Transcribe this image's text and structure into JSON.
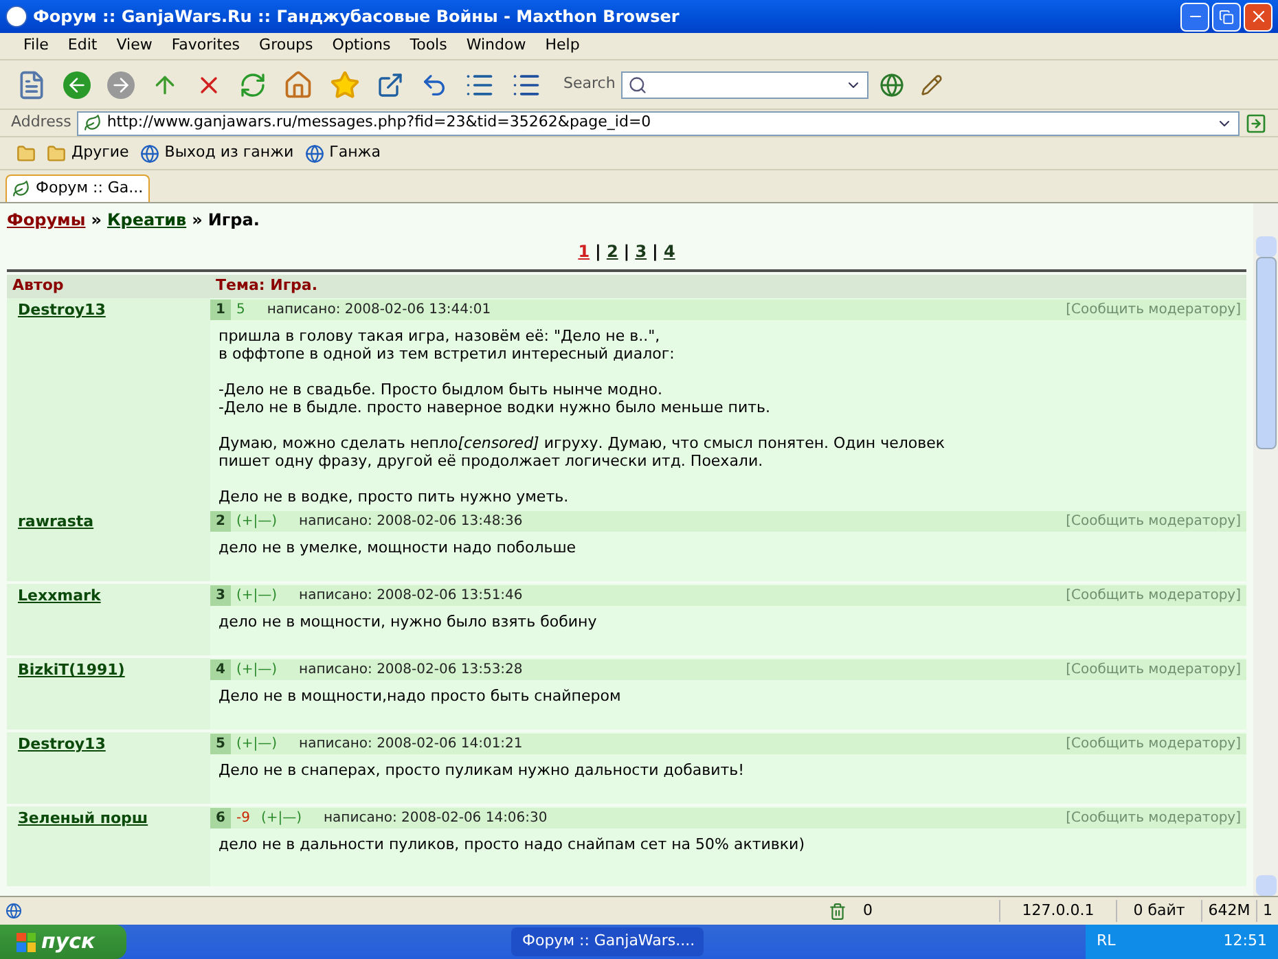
{
  "window": {
    "title": "Форум :: GanjaWars.Ru :: Ганджубасовые Войны - Maxthon Browser"
  },
  "menu": [
    "File",
    "Edit",
    "View",
    "Favorites",
    "Groups",
    "Options",
    "Tools",
    "Window",
    "Help"
  ],
  "search": {
    "label": "Search"
  },
  "address": {
    "label": "Address",
    "url": "http://www.ganjawars.ru/messages.php?fid=23&tid=35262&page_id=0"
  },
  "links": [
    {
      "kind": "folder"
    },
    {
      "kind": "folder",
      "label": "Другие"
    },
    {
      "kind": "page",
      "label": "Выход из ганжи"
    },
    {
      "kind": "page",
      "label": "Ганжа"
    }
  ],
  "tabs": [
    {
      "label": "Форум :: Ga...",
      "selected": true
    }
  ],
  "breadcrumb": [
    {
      "kind": "link",
      "label": "Форумы",
      "color": "#8b0000"
    },
    {
      "kind": "sep",
      "label": "»"
    },
    {
      "kind": "link",
      "label": "Креатив",
      "color": "#004400"
    },
    {
      "kind": "sep",
      "label": "»"
    },
    {
      "kind": "text",
      "label": "Игра."
    }
  ],
  "pager": [
    {
      "kind": "page",
      "label": "1",
      "selected": true
    },
    {
      "kind": "sep",
      "label": "|"
    },
    {
      "kind": "page",
      "label": "2",
      "selected": false
    },
    {
      "kind": "sep",
      "label": "|"
    },
    {
      "kind": "page",
      "label": "3",
      "selected": false
    },
    {
      "kind": "sep",
      "label": "|"
    },
    {
      "kind": "page",
      "label": "4",
      "selected": false
    }
  ],
  "table": {
    "columns": [
      "Автор",
      "Тема: Игра."
    ],
    "posts": [
      {
        "author": "Destroy13",
        "number": "1",
        "rating": "5",
        "color": "#2a8a2a",
        "date": "написано: 2008-02-06 13:44:01",
        "report": "[Сообщить модератору]",
        "paragraphs": [
          [
            [
              {
                "text": "пришла в голову такая игра, назовём её: \"Дело не в..\","
              }
            ],
            [
              {
                "text": "в оффтопе в одной из тем встретил интересный диалог:"
              }
            ]
          ],
          [
            [
              {
                "text": "-Дело не в свадьбе. Просто быдлом быть нынче модно."
              }
            ],
            [
              {
                "text": "-Дело не в быдле. просто наверное водки нужно было меньше пить."
              }
            ]
          ],
          [
            [
              {
                "text": "Думаю, можно сделать непло"
              },
              {
                "text": "[censored]",
                "italic": true
              },
              {
                "text": " игруху. Думаю, что смысл понятен. Один человек"
              }
            ],
            [
              {
                "text": "пишет одну фразу, другой её продолжает логически итд. Поехали."
              }
            ]
          ],
          [
            [
              {
                "text": "Дело не в водке, просто пить нужно уметь."
              }
            ]
          ]
        ]
      },
      {
        "author": "rawrasta",
        "number": "2",
        "vote": "(+|—)",
        "date": "написано: 2008-02-06 13:48:36",
        "report": "[Сообщить модератору]",
        "paragraphs": [
          [
            [
              {
                "text": "дело не в умелке, мощности надо побольше"
              }
            ]
          ]
        ]
      },
      {
        "author": "Lexxmark",
        "number": "3",
        "vote": "(+|—)",
        "date": "написано: 2008-02-06 13:51:46",
        "report": "[Сообщить модератору]",
        "paragraphs": [
          [
            [
              {
                "text": "дело не в мощности, нужно было взять бобину"
              }
            ]
          ]
        ]
      },
      {
        "author": "BizkiT(1991)",
        "number": "4",
        "vote": "(+|—)",
        "date": "написано: 2008-02-06 13:53:28",
        "report": "[Сообщить модератору]",
        "paragraphs": [
          [
            [
              {
                "text": "Дело не в мощности,надо просто быть снайпером"
              }
            ]
          ]
        ]
      },
      {
        "author": "Destroy13",
        "number": "5",
        "vote": "(+|—)",
        "date": "написано: 2008-02-06 14:01:21",
        "report": "[Сообщить модератору]",
        "paragraphs": [
          [
            [
              {
                "text": "Дело не в снаперах, просто пуликам нужно дальности добавить!"
              }
            ]
          ]
        ]
      },
      {
        "author": "Зеленый порш",
        "number": "6",
        "rating": "-9",
        "color": "#cc2200",
        "vote": "(+|—)",
        "date": "написано: 2008-02-06 14:06:30",
        "report": "[Сообщить модератору]",
        "paragraphs": [
          [
            [
              {
                "text": "дело не в дальности пуликов, просто надо снайпам сет на 50% активки)"
              }
            ]
          ]
        ]
      }
    ]
  },
  "status": {
    "count": "0",
    "ip": "127.0.0.1",
    "traffic": "0 байт",
    "memory": "642M",
    "column_5": "1"
  },
  "taskbar": {
    "start": "пуск",
    "task": "Форум :: GanjaWars....",
    "lang": "RL",
    "clock": "12:51"
  }
}
